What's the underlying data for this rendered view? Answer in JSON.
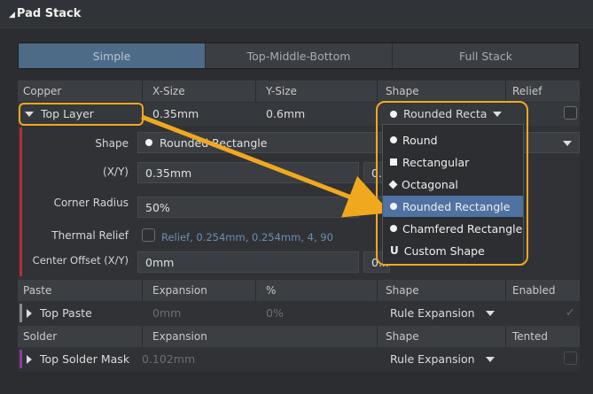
{
  "panel": {
    "title": "Pad Stack"
  },
  "tabs": [
    "Simple",
    "Top-Middle-Bottom",
    "Full Stack"
  ],
  "copper": {
    "headers": [
      "Copper",
      "X-Size",
      "Y-Size",
      "Shape",
      "Relief"
    ],
    "layer": "Top Layer",
    "x_size": "0.35mm",
    "y_size": "0.6mm",
    "shape_value": "Rounded Recta"
  },
  "details": {
    "shape_label": "Shape",
    "shape_value": "Rounded Rectangle",
    "xy_label": "(X/Y)",
    "x_value": "0.35mm",
    "y_value_partial": "0.",
    "corner_label": "Corner Radius",
    "corner_value": "50%",
    "thermal_label": "Thermal Relief",
    "thermal_value": "Relief, 0.254mm, 0.254mm, 4, 90",
    "offset_label": "Center Offset (X/Y)",
    "offset_x": "0mm",
    "offset_y_partial": "0..."
  },
  "shape_dropdown": {
    "items": [
      {
        "label": "Round",
        "icon": "circle-icon"
      },
      {
        "label": "Rectangular",
        "icon": "square-icon"
      },
      {
        "label": "Octagonal",
        "icon": "diamond-icon"
      },
      {
        "label": "Rounded Rectangle",
        "icon": "circle-icon",
        "selected": true
      },
      {
        "label": "Chamfered Rectangle",
        "icon": "circle-icon"
      },
      {
        "label": "Custom Shape",
        "icon": "custom-shape-icon"
      }
    ],
    "custom_icon_glyph": "U"
  },
  "paste": {
    "headers": [
      "Paste",
      "Expansion",
      "%",
      "Shape",
      "Enabled"
    ],
    "row_label": "Top Paste",
    "expansion": "0mm",
    "percent": "0%",
    "shape": "Rule Expansion"
  },
  "solder": {
    "headers": [
      "Solder",
      "Expansion",
      "Shape",
      "Tented"
    ],
    "row_label": "Top Solder Mask",
    "expansion": "0.102mm",
    "shape": "Rule Expansion"
  },
  "colors": {
    "highlight": "#f0a91e",
    "selected": "#4f72a3",
    "tab_active": "#4d6a86",
    "error_bar": "#b3303a"
  }
}
